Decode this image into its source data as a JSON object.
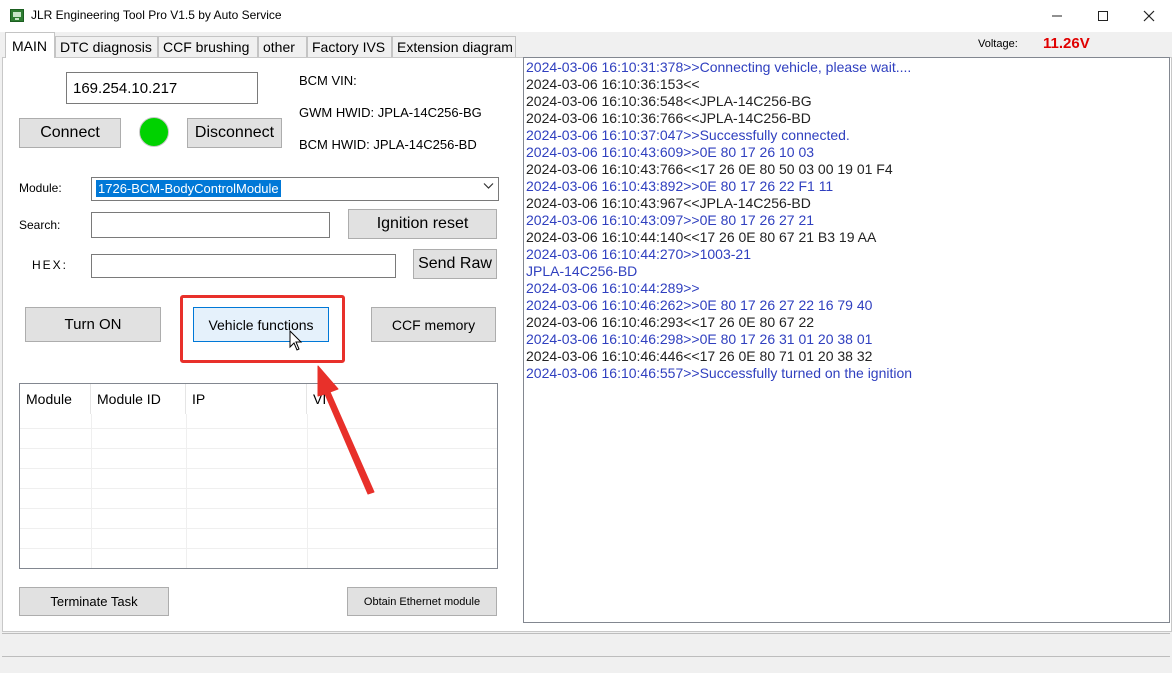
{
  "window": {
    "title": "JLR Engineering Tool Pro V1.5 by Auto Service",
    "min_icon": "minimize-icon",
    "max_icon": "maximize-icon",
    "close_icon": "close-icon"
  },
  "tabs": [
    {
      "label": "MAIN",
      "active": true
    },
    {
      "label": "DTC diagnosis"
    },
    {
      "label": "CCF brushing"
    },
    {
      "label": "other"
    },
    {
      "label": "Factory IVS"
    },
    {
      "label": "Extension diagram"
    }
  ],
  "voltage": {
    "label": "Voltage:",
    "value": "11.26V",
    "color": "#e00000"
  },
  "connection": {
    "ip": "169.254.10.217",
    "connect_label": "Connect",
    "disconnect_label": "Disconnect",
    "status_color": "#00d200",
    "bcm_vin": "BCM VIN:",
    "gwm_hwid": "GWM HWID: JPLA-14C256-BG",
    "bcm_hwid": "BCM HWID: JPLA-14C256-BD"
  },
  "form": {
    "module_label": "Module:",
    "module_selected": "1726-BCM-BodyControlModule",
    "search_label": "Search:",
    "search_value": "",
    "ignition_reset_label": "Ignition reset",
    "hex_label": "HEX:",
    "hex_value": "",
    "send_raw_label": "Send Raw"
  },
  "actions": {
    "turn_on": "Turn ON",
    "vehicle_functions": "Vehicle functions",
    "ccf_memory": "CCF memory",
    "terminate_task": "Terminate Task",
    "obtain_ethernet": "Obtain Ethernet module"
  },
  "table": {
    "columns": [
      "Module",
      "Module ID",
      "IP",
      "VI"
    ],
    "rows": []
  },
  "log": [
    {
      "text": "2024-03-06 16:10:31:378>>Connecting vehicle, please wait....",
      "dir": "out"
    },
    {
      "text": "2024-03-06 16:10:36:153<<",
      "dir": "in"
    },
    {
      "text": "2024-03-06 16:10:36:548<<JPLA-14C256-BG",
      "dir": "in"
    },
    {
      "text": "2024-03-06 16:10:36:766<<JPLA-14C256-BD",
      "dir": "in"
    },
    {
      "text": "2024-03-06 16:10:37:047>>Successfully connected.",
      "dir": "out"
    },
    {
      "text": "2024-03-06 16:10:43:609>>0E 80 17 26 10 03",
      "dir": "out"
    },
    {
      "text": "2024-03-06 16:10:43:766<<17 26 0E 80 50 03 00 19 01 F4",
      "dir": "in"
    },
    {
      "text": "2024-03-06 16:10:43:892>>0E 80 17 26 22 F1 11",
      "dir": "out"
    },
    {
      "text": "2024-03-06 16:10:43:967<<JPLA-14C256-BD",
      "dir": "in"
    },
    {
      "text": "2024-03-06 16:10:43:097>>0E 80 17 26 27 21",
      "dir": "out"
    },
    {
      "text": "2024-03-06 16:10:44:140<<17 26 0E 80 67 21 B3 19 AA",
      "dir": "in"
    },
    {
      "text": "2024-03-06 16:10:44:270>>1003-21",
      "dir": "out"
    },
    {
      "text": "JPLA-14C256-BD",
      "dir": "out"
    },
    {
      "text": "2024-03-06 16:10:44:289>>",
      "dir": "out"
    },
    {
      "text": "2024-03-06 16:10:46:262>>0E 80 17 26 27 22 16 79 40",
      "dir": "out"
    },
    {
      "text": "2024-03-06 16:10:46:293<<17 26 0E 80 67 22",
      "dir": "in"
    },
    {
      "text": "2024-03-06 16:10:46:298>>0E 80 17 26 31 01 20 38 01",
      "dir": "out"
    },
    {
      "text": "2024-03-06 16:10:46:446<<17 26 0E 80 71 01 20 38 32",
      "dir": "in"
    },
    {
      "text": "2024-03-06 16:10:46:557>>Successfully turned on the ignition",
      "dir": "out"
    }
  ]
}
